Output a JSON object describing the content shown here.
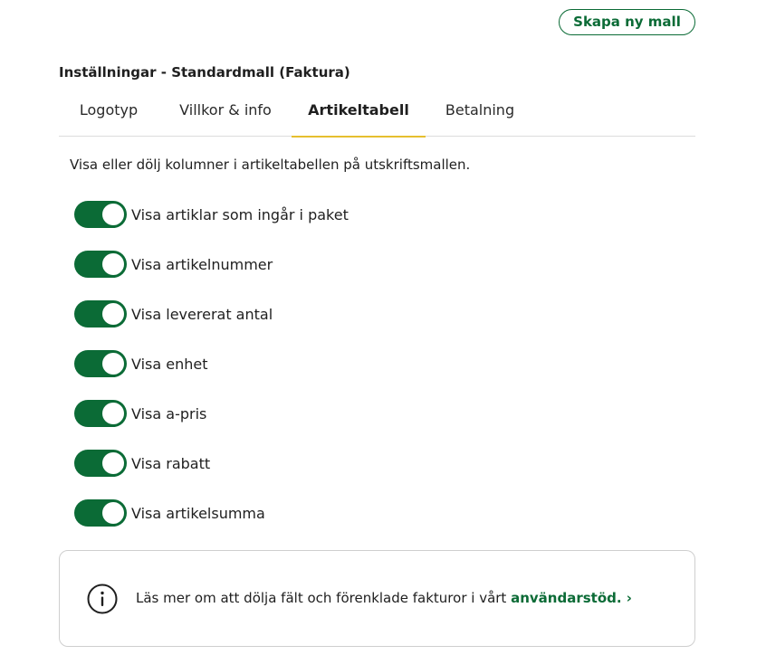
{
  "header": {
    "new_template_label": "Skapa ny mall"
  },
  "settings": {
    "title": "Inställningar - Standardmall (Faktura)"
  },
  "tabs": [
    {
      "label": "Logotyp",
      "active": false
    },
    {
      "label": "Villkor & info",
      "active": false
    },
    {
      "label": "Artikeltabell",
      "active": true
    },
    {
      "label": "Betalning",
      "active": false
    }
  ],
  "article_table": {
    "description": "Visa eller dölj kolumner i artikeltabellen på utskriftsmallen.",
    "toggles": [
      {
        "label": "Visa artiklar som ingår i paket",
        "on": true
      },
      {
        "label": "Visa artikelnummer",
        "on": true
      },
      {
        "label": "Visa levererat antal",
        "on": true
      },
      {
        "label": "Visa enhet",
        "on": true
      },
      {
        "label": "Visa a-pris",
        "on": true
      },
      {
        "label": "Visa rabatt",
        "on": true
      },
      {
        "label": "Visa artikelsumma",
        "on": true
      }
    ]
  },
  "info": {
    "icon": "info-icon",
    "text": "Läs mer om att dölja fält och förenklade fakturor i vårt ",
    "link_label": "användarstöd. ›"
  },
  "colors": {
    "accent_green": "#0b6b36",
    "tab_underline": "#e6bf2f",
    "border": "#cfcfcf"
  }
}
